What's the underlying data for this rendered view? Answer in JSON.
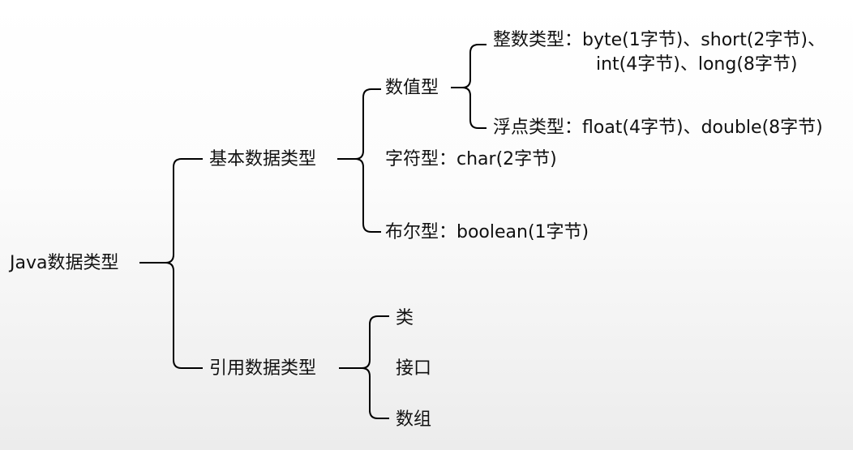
{
  "root": {
    "label": "Java数据类型"
  },
  "primitive": {
    "label": "基本数据类型",
    "numeric": {
      "label": "数值型",
      "integer": {
        "line1": "整数类型：byte(1字节)、short(2字节)、",
        "line2": "int(4字节)、long(8字节)"
      },
      "float": {
        "label": "浮点类型：float(4字节)、double(8字节)"
      }
    },
    "char": {
      "label": "字符型：char(2字节)"
    },
    "boolean": {
      "label": "布尔型：boolean(1字节)"
    }
  },
  "reference": {
    "label": "引用数据类型",
    "items": [
      "类",
      "接口",
      "数组"
    ]
  }
}
